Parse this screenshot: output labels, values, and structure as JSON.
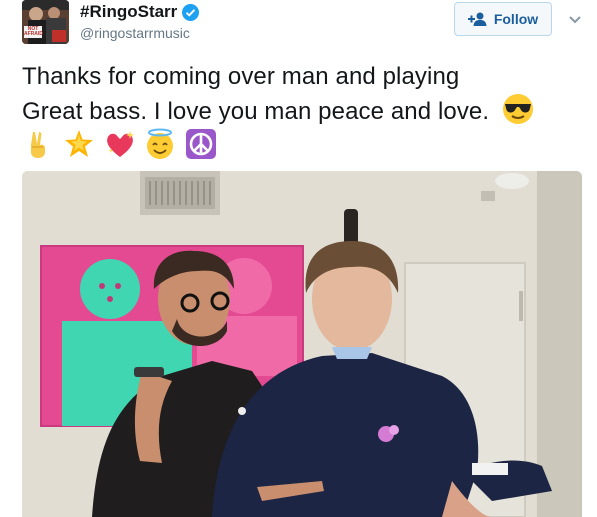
{
  "user": {
    "display_name": "#RingoStarr",
    "handle": "@ringostarrmusic",
    "avatar_text": "NOT AFRAID"
  },
  "follow": {
    "label": "Follow"
  },
  "tweet": {
    "line1": "Thanks for coming over man and playing",
    "line2": "Great bass. I love you man peace and love.",
    "emojis": [
      "sunglasses-emoji",
      "victory-hand-emoji",
      "glowing-star-emoji",
      "sparkling-heart-emoji",
      "halo-face-emoji",
      "peace-symbol-emoji"
    ]
  },
  "colors": {
    "verified": "#1da1f2",
    "follow_text": "#1b5e9e",
    "handle": "#657786"
  }
}
